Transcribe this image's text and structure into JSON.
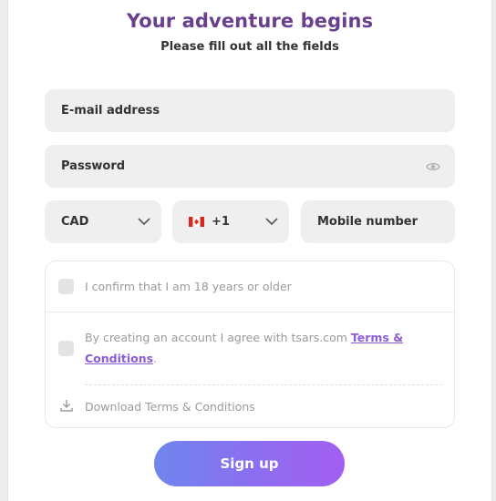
{
  "header": {
    "title": "Your adventure begins",
    "subtitle": "Please fill out all the fields"
  },
  "form": {
    "email_label": "E-mail address",
    "password_label": "Password",
    "currency_value": "CAD",
    "phone_code_value": "+1",
    "phone_flag": "canada-flag-icon",
    "mobile_label": "Mobile number"
  },
  "consents": {
    "age_text": "I confirm that I am 18 years or older",
    "terms_prefix": "By creating an account I agree with tsars.com",
    "terms_link": "Terms & Conditions",
    "terms_suffix": ".",
    "download_text": "Download Terms & Conditions"
  },
  "actions": {
    "signup_label": "Sign up"
  },
  "colors": {
    "title": "#6a3f8e",
    "link": "#8b5cd6",
    "button_gradient_start": "#6f86ee",
    "button_gradient_end": "#a35ef0"
  }
}
